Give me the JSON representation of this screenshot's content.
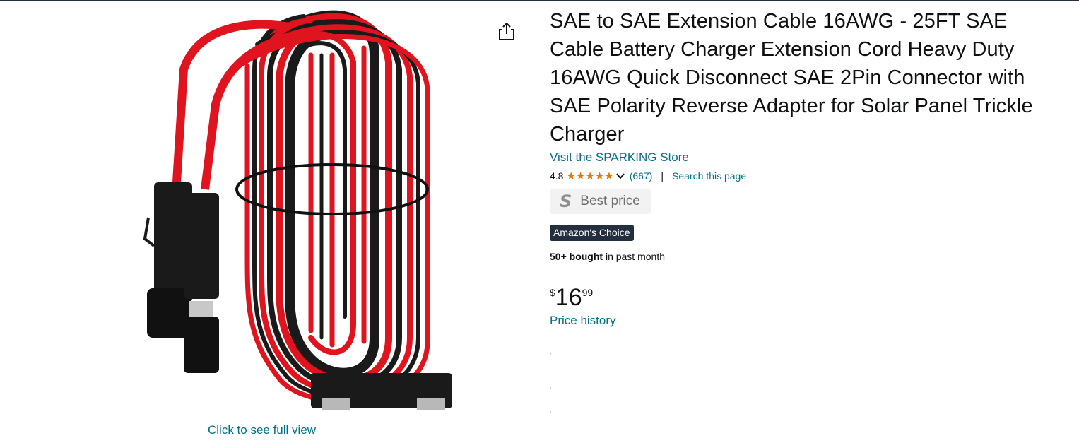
{
  "product": {
    "title": "SAE to SAE Extension Cable 16AWG - 25FT SAE Cable Battery Charger Extension Cord Heavy Duty 16AWG Quick Disconnect SAE 2Pin Connector with SAE Polarity Reverse Adapter for Solar Panel Trickle Charger",
    "store_link": "Visit the SPARKING Store",
    "rating": "4.8",
    "rating_stars": 4.8,
    "rating_count": "(667)",
    "separator": "|",
    "search_page": "Search this page",
    "best_price_logo": "S",
    "best_price_label": "Best price",
    "badge": "Amazon's Choice",
    "bought_bold": "50+ bought",
    "bought_rest": " in past month",
    "price_symbol": "$",
    "price_whole": "16",
    "price_fraction": "99",
    "price_history": "Price history"
  },
  "image": {
    "see_full_view": "Click to see full view"
  },
  "colors": {
    "link": "#007185",
    "star": "#e77600",
    "badge_bg": "#232f3e",
    "cable_red": "#e0141e",
    "cable_black": "#1a1a1a"
  },
  "icons": {
    "share": "share-icon",
    "chevron": "chevron-down-icon",
    "star": "star-icon"
  }
}
